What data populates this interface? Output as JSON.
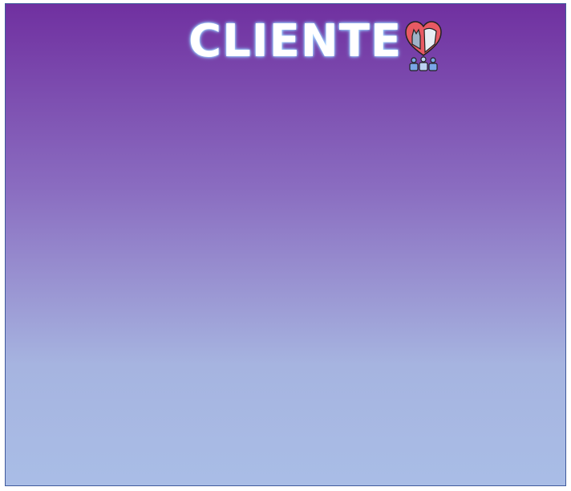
{
  "title": "CLIENTE",
  "icon": "heart-pets-people-icon",
  "colors": {
    "gradient_top": "#7030a0",
    "gradient_bottom": "#a9bde6",
    "title": "#ffffff"
  }
}
